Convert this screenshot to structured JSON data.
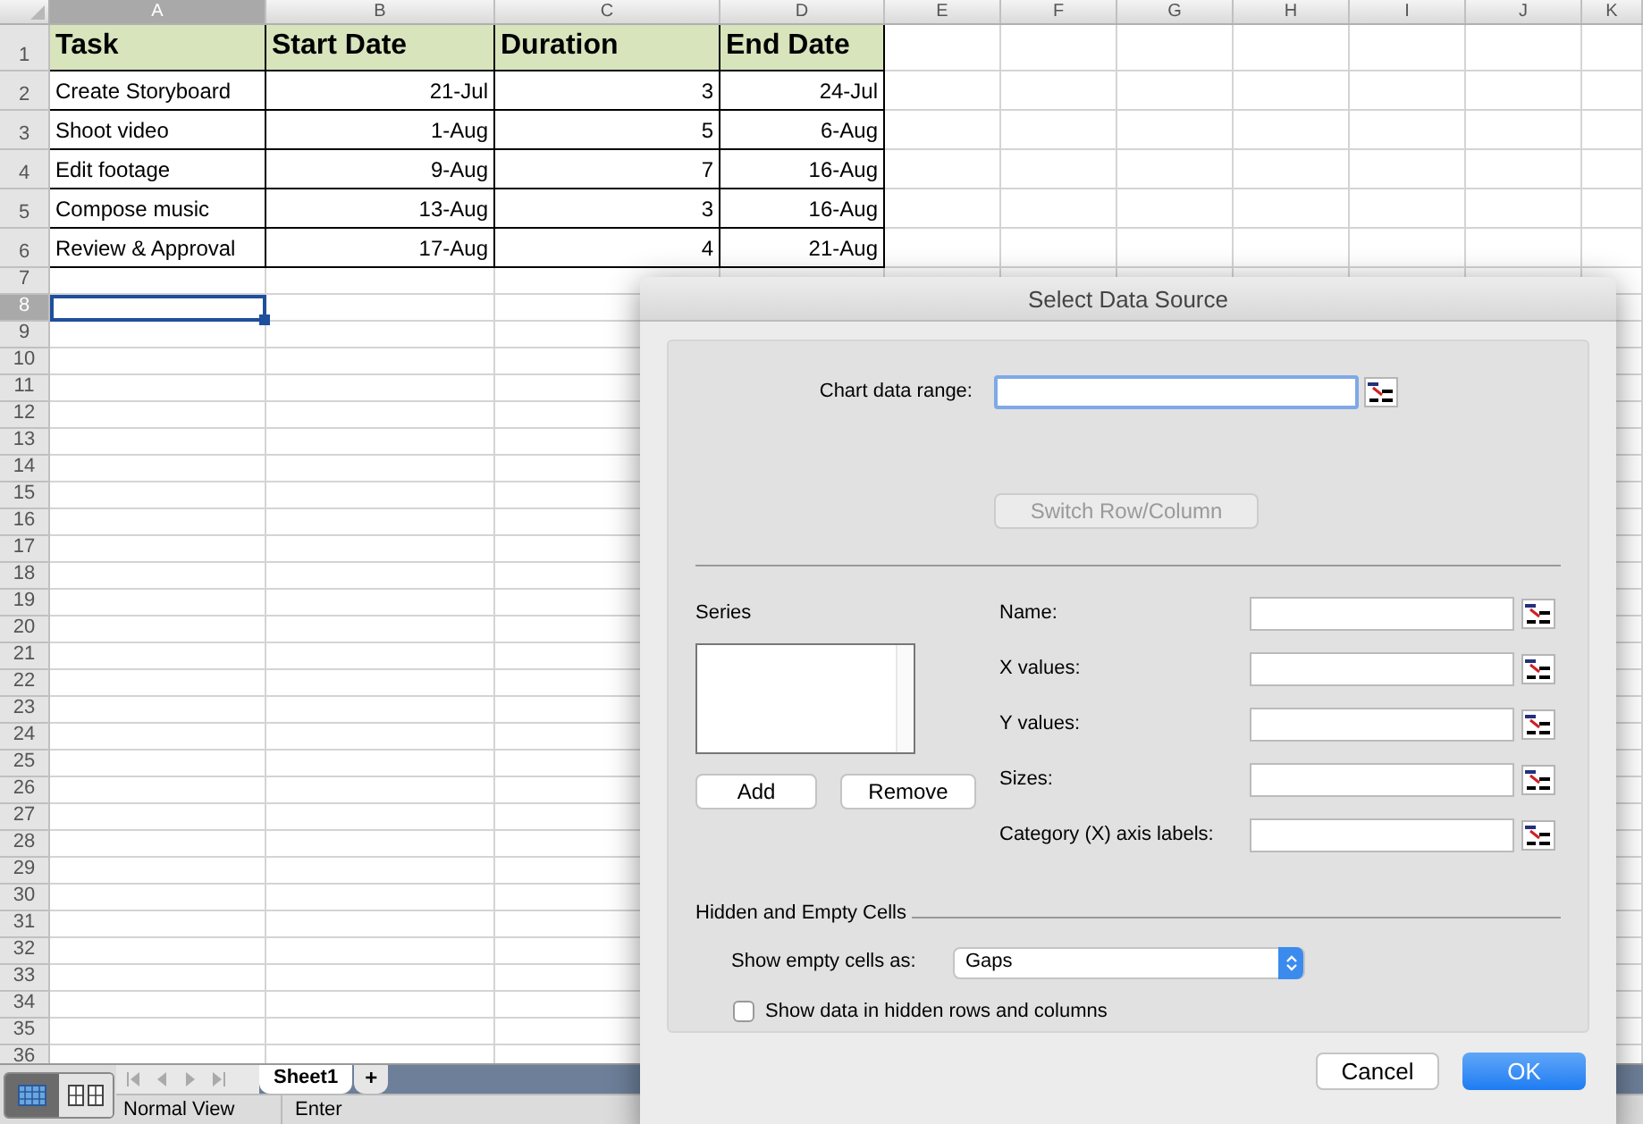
{
  "columns": [
    {
      "label": "A",
      "selected": true
    },
    {
      "label": "B",
      "selected": false
    },
    {
      "label": "C",
      "selected": false
    },
    {
      "label": "D",
      "selected": false
    },
    {
      "label": "E",
      "selected": false
    },
    {
      "label": "F",
      "selected": false
    },
    {
      "label": "G",
      "selected": false
    },
    {
      "label": "H",
      "selected": false
    },
    {
      "label": "I",
      "selected": false
    },
    {
      "label": "J",
      "selected": false
    },
    {
      "label": "K",
      "selected": false
    }
  ],
  "rows": [
    {
      "number": "1",
      "selected": false,
      "cells": [
        {
          "kind": "header",
          "text": "Task"
        },
        {
          "kind": "header",
          "text": "Start Date"
        },
        {
          "kind": "header",
          "text": "Duration"
        },
        {
          "kind": "header",
          "text": "End Date"
        }
      ]
    },
    {
      "number": "2",
      "selected": false,
      "cells": [
        {
          "kind": "text",
          "text": "Create Storyboard"
        },
        {
          "kind": "number",
          "text": "21-Jul"
        },
        {
          "kind": "number",
          "text": "3"
        },
        {
          "kind": "number",
          "text": "24-Jul"
        }
      ]
    },
    {
      "number": "3",
      "selected": false,
      "cells": [
        {
          "kind": "text",
          "text": "Shoot video"
        },
        {
          "kind": "number",
          "text": "1-Aug"
        },
        {
          "kind": "number",
          "text": "5"
        },
        {
          "kind": "number",
          "text": "6-Aug"
        }
      ]
    },
    {
      "number": "4",
      "selected": false,
      "cells": [
        {
          "kind": "text",
          "text": "Edit footage"
        },
        {
          "kind": "number",
          "text": "9-Aug"
        },
        {
          "kind": "number",
          "text": "7"
        },
        {
          "kind": "number",
          "text": "16-Aug"
        }
      ]
    },
    {
      "number": "5",
      "selected": false,
      "cells": [
        {
          "kind": "text",
          "text": "Compose music"
        },
        {
          "kind": "number",
          "text": "13-Aug"
        },
        {
          "kind": "number",
          "text": "3"
        },
        {
          "kind": "number",
          "text": "16-Aug"
        }
      ]
    },
    {
      "number": "6",
      "selected": false,
      "cells": [
        {
          "kind": "text",
          "text": "Review & Approval"
        },
        {
          "kind": "number",
          "text": "17-Aug"
        },
        {
          "kind": "number",
          "text": "4"
        },
        {
          "kind": "number",
          "text": "21-Aug"
        }
      ]
    },
    {
      "number": "7",
      "selected": false
    },
    {
      "number": "8",
      "selected": true
    },
    {
      "number": "9",
      "selected": false
    },
    {
      "number": "10",
      "selected": false
    },
    {
      "number": "11",
      "selected": false
    },
    {
      "number": "12",
      "selected": false
    },
    {
      "number": "13",
      "selected": false
    },
    {
      "number": "14",
      "selected": false
    },
    {
      "number": "15",
      "selected": false
    },
    {
      "number": "16",
      "selected": false
    },
    {
      "number": "17",
      "selected": false
    },
    {
      "number": "18",
      "selected": false
    },
    {
      "number": "19",
      "selected": false
    },
    {
      "number": "20",
      "selected": false
    },
    {
      "number": "21",
      "selected": false
    },
    {
      "number": "22",
      "selected": false
    },
    {
      "number": "23",
      "selected": false
    },
    {
      "number": "24",
      "selected": false
    },
    {
      "number": "25",
      "selected": false
    },
    {
      "number": "26",
      "selected": false
    },
    {
      "number": "27",
      "selected": false
    },
    {
      "number": "28",
      "selected": false
    },
    {
      "number": "29",
      "selected": false
    },
    {
      "number": "30",
      "selected": false
    },
    {
      "number": "31",
      "selected": false
    },
    {
      "number": "32",
      "selected": false
    },
    {
      "number": "33",
      "selected": false
    },
    {
      "number": "34",
      "selected": false
    },
    {
      "number": "35",
      "selected": false
    },
    {
      "number": "36",
      "selected": false
    }
  ],
  "view_buttons": [
    {
      "kind": "normal",
      "selected": true
    },
    {
      "kind": "page_layout",
      "selected": false
    }
  ],
  "sheet_tabs": [
    {
      "label": "Sheet1",
      "selected": true
    }
  ],
  "add_sheet": "+",
  "status_bar": [
    "Normal View",
    "Enter"
  ],
  "dialog": {
    "title": "Select Data Source",
    "chart_data_range_label": "Chart data range:",
    "switch_button": {
      "label": "Switch Row/Column",
      "disabled": true
    },
    "series_label": "Series",
    "series_buttons": [
      "Add",
      "Remove"
    ],
    "fields": [
      {
        "label": "Name:"
      },
      {
        "label": "X values:"
      },
      {
        "label": "Y values:"
      },
      {
        "label": "Sizes:"
      },
      {
        "label": "Category (X) axis labels:"
      }
    ],
    "hidden_cells_heading": "Hidden and Empty Cells",
    "empty_cells_label": "Show empty cells as:",
    "empty_cells_value": "Gaps",
    "hidden_rows_checkbox": {
      "label": "Show data in hidden rows and columns",
      "checked": false
    },
    "buttons": [
      {
        "label": "Cancel",
        "kind": "secondary"
      },
      {
        "label": "OK",
        "kind": "primary"
      }
    ]
  }
}
